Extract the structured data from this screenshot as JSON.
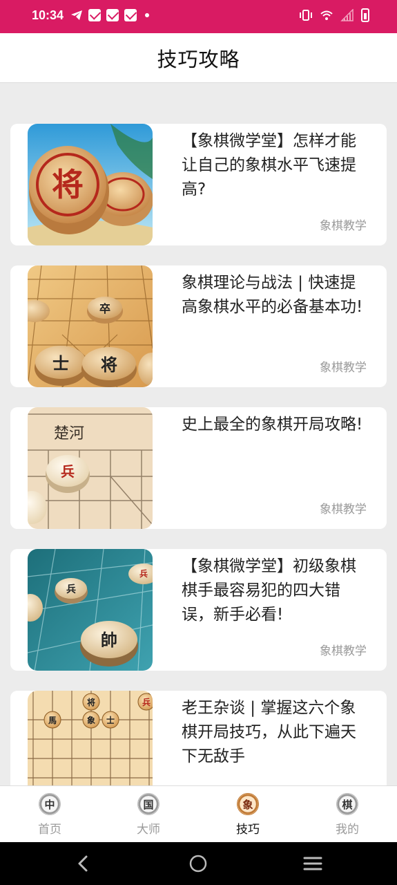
{
  "status_bar": {
    "time": "10:34",
    "left_icons": [
      "telegram-icon",
      "mail-icon",
      "mail-icon",
      "mail-icon",
      "dot-icon"
    ],
    "right_icons": [
      "vibrate-icon",
      "wifi-icon",
      "signal-icon",
      "battery-icon"
    ]
  },
  "header": {
    "title": "技巧攻略"
  },
  "articles": [
    {
      "title": "【象棋微学堂】怎样才能让自己的象棋水平飞速提高?",
      "tag": "象棋教学"
    },
    {
      "title": "象棋理论与战法 | 快速提高象棋水平的必备基本功!",
      "tag": "象棋教学"
    },
    {
      "title": "史上最全的象棋开局攻略!",
      "tag": "象棋教学"
    },
    {
      "title": "【象棋微学堂】初级象棋棋手最容易犯的四大错误，新手必看!",
      "tag": "象棋教学"
    },
    {
      "title": "老王杂谈 | 掌握这六个象棋开局技巧，从此下遍天下无敌手",
      "tag": ""
    }
  ],
  "bottom_nav": [
    {
      "icon_char": "中",
      "label": "首页",
      "active": false
    },
    {
      "icon_char": "国",
      "label": "大师",
      "active": false
    },
    {
      "icon_char": "象",
      "label": "技巧",
      "active": true
    },
    {
      "icon_char": "棋",
      "label": "我的",
      "active": false
    }
  ],
  "colors": {
    "status_bar": "#d91b63",
    "tag": "#9a9a9a",
    "background": "#ececec"
  },
  "system_nav": [
    "back-icon",
    "home-icon",
    "recents-icon"
  ]
}
